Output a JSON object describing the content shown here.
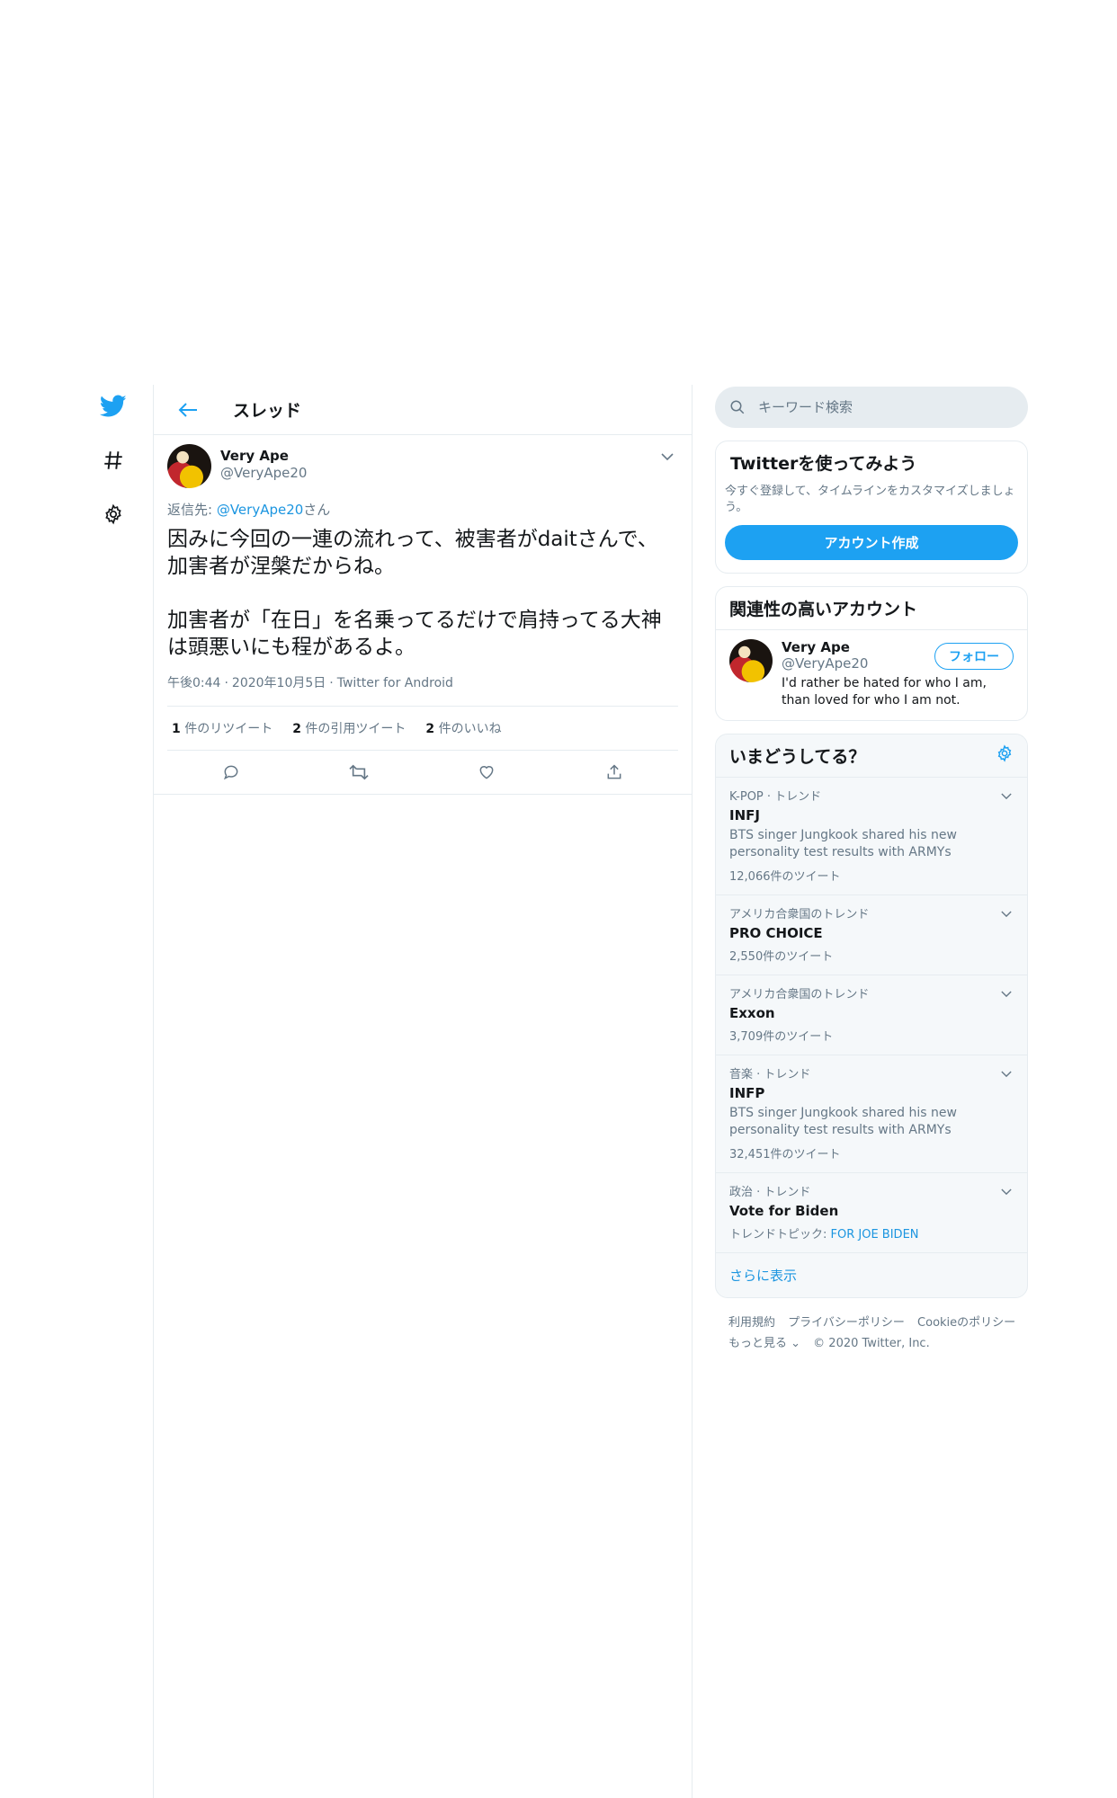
{
  "nav": {
    "items": [
      "twitter-logo",
      "explore-hashtag",
      "settings"
    ]
  },
  "header": {
    "title": "スレッド"
  },
  "tweet": {
    "user_name": "Very Ape",
    "user_handle": "@VeryApe20",
    "reply_prefix": "返信先: ",
    "reply_handle": "@VeryApe20",
    "reply_suffix": "さん",
    "text": "因みに今回の一連の流れって、被害者がdaitさんで、\n加害者が涅槃だからね。\n\n加害者が「在日」を名乗ってるだけで肩持ってる大神\nは頭悪いにも程があるよ。",
    "time": "午後0:44",
    "date": "2020年10月5日",
    "source": "Twitter for Android",
    "retweets_count": "1",
    "retweets_label": " 件のリツイート",
    "quotes_count": "2",
    "quotes_label": " 件の引用ツイート",
    "likes_count": "2",
    "likes_label": " 件のいいね"
  },
  "search": {
    "placeholder": "キーワード検索"
  },
  "signup": {
    "title": "Twitterを使ってみよう",
    "desc": "今すぐ登録して、タイムラインをカスタマイズしましょう。",
    "button": "アカウント作成"
  },
  "related": {
    "title": "関連性の高いアカウント",
    "name": "Very Ape",
    "handle": "@VeryApe20",
    "bio": "I'd rather be hated for who I am, than loved for who I am not.",
    "follow": "フォロー"
  },
  "trends": {
    "title": "いまどうしてる？",
    "items": [
      {
        "context": "K-POP · トレンド",
        "name": "INFJ",
        "desc": "BTS singer Jungkook shared his new personality test results with ARMYs",
        "count": "12,066件のツイート"
      },
      {
        "context": "アメリカ合衆国のトレンド",
        "name": "PRO CHOICE",
        "desc": "",
        "count": "2,550件のツイート"
      },
      {
        "context": "アメリカ合衆国のトレンド",
        "name": "Exxon",
        "desc": "",
        "count": "3,709件のツイート"
      },
      {
        "context": "音楽 · トレンド",
        "name": "INFP",
        "desc": "BTS singer Jungkook shared his new personality test results with ARMYs",
        "count": "32,451件のツイート"
      },
      {
        "context": "政治 · トレンド",
        "name": "Vote for Biden",
        "topic_label": "トレンドトピック: ",
        "topic_link": "FOR JOE BIDEN"
      }
    ],
    "show_more": "さらに表示"
  },
  "footer": {
    "terms": "利用規約",
    "privacy": "プライバシーポリシー",
    "cookie": "Cookieのポリシー",
    "more": "もっと見る ⌄",
    "copyright": "© 2020 Twitter, Inc."
  },
  "colors": {
    "accent": "#1da1f2",
    "link": "#1b95e0",
    "muted": "#657786",
    "border": "#e6ecf0",
    "panel": "#f5f8fa"
  }
}
